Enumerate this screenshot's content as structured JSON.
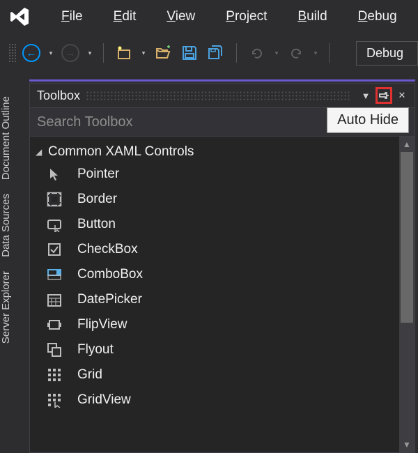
{
  "menubar": {
    "items": [
      {
        "key": "F",
        "rest": "ile"
      },
      {
        "key": "E",
        "rest": "dit"
      },
      {
        "key": "V",
        "rest": "iew"
      },
      {
        "key": "P",
        "rest": "roject"
      },
      {
        "key": "B",
        "rest": "uild"
      },
      {
        "key": "D",
        "rest": "ebug"
      }
    ]
  },
  "toolbar": {
    "config_label": "Debug"
  },
  "vertical_tabs": [
    "Document Outline",
    "Data Sources",
    "Server Explorer"
  ],
  "toolbox": {
    "title": "Toolbox",
    "tooltip": "Auto Hide",
    "search_placeholder": "Search Toolbox",
    "category": "Common XAML Controls",
    "items": [
      {
        "name": "Pointer",
        "icon": "pointer"
      },
      {
        "name": "Border",
        "icon": "border"
      },
      {
        "name": "Button",
        "icon": "button"
      },
      {
        "name": "CheckBox",
        "icon": "checkbox"
      },
      {
        "name": "ComboBox",
        "icon": "combobox"
      },
      {
        "name": "DatePicker",
        "icon": "datepicker"
      },
      {
        "name": "FlipView",
        "icon": "flipview"
      },
      {
        "name": "Flyout",
        "icon": "flyout"
      },
      {
        "name": "Grid",
        "icon": "grid"
      },
      {
        "name": "GridView",
        "icon": "gridview"
      }
    ]
  }
}
